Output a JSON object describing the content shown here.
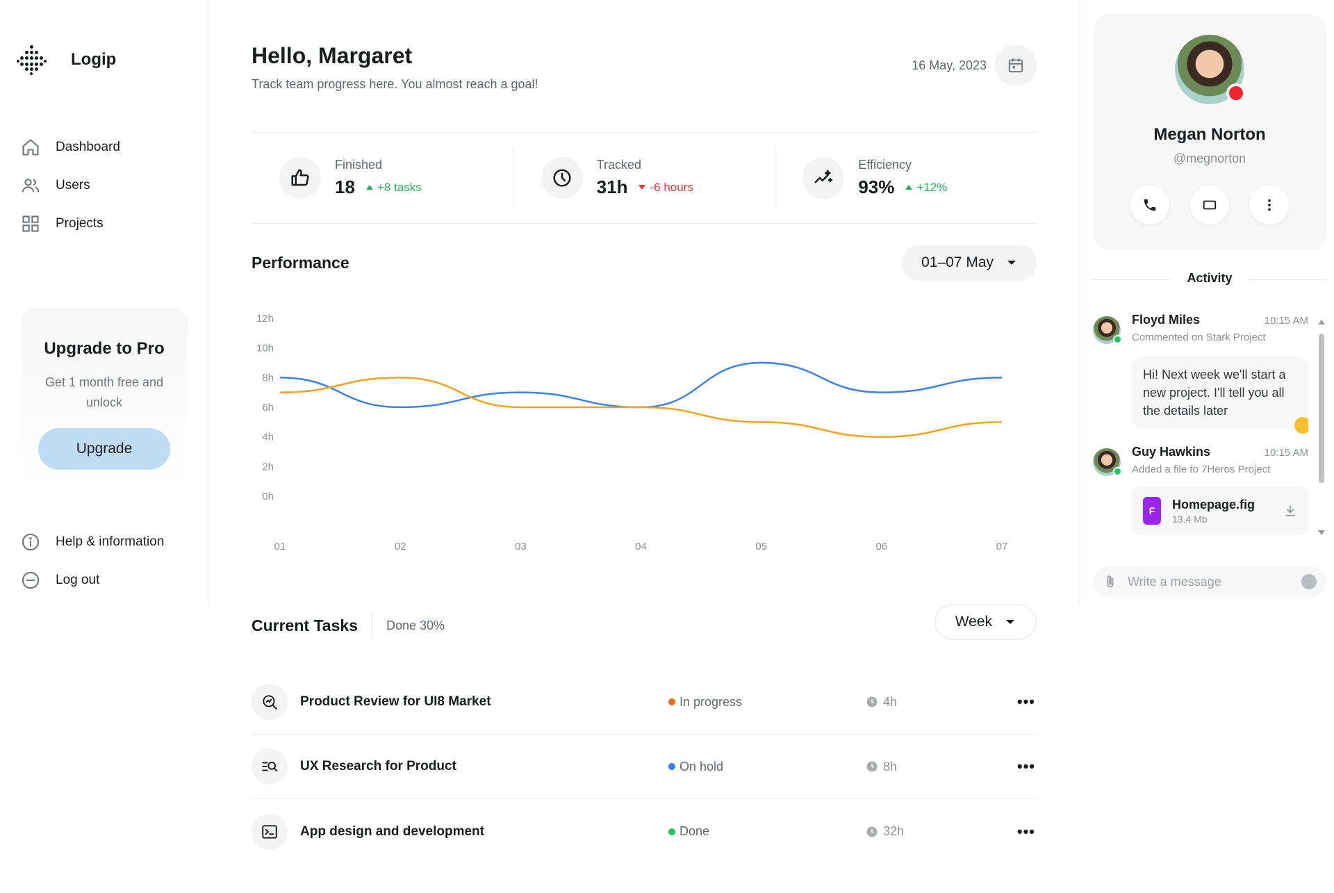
{
  "app": {
    "name": "Logip"
  },
  "sidebar": {
    "items": [
      {
        "label": "Dashboard",
        "icon": "home-icon"
      },
      {
        "label": "Users",
        "icon": "users-icon"
      },
      {
        "label": "Projects",
        "icon": "grid-icon"
      }
    ],
    "upgrade": {
      "title": "Upgrade to Pro",
      "text": "Get 1 month free and unlock",
      "button": "Upgrade"
    },
    "bottom_items": [
      {
        "label": "Help & information",
        "icon": "info-icon"
      },
      {
        "label": "Log out",
        "icon": "logout-icon"
      }
    ]
  },
  "header": {
    "greeting": "Hello, Margaret",
    "subtitle": "Track team progress here. You almost reach a goal!",
    "date": "16 May, 2023"
  },
  "stats": [
    {
      "label": "Finished",
      "value": "18",
      "delta": "+8 tasks",
      "trend": "up",
      "icon": "thumbs-up-icon"
    },
    {
      "label": "Tracked",
      "value": "31h",
      "delta": "-6 hours",
      "trend": "down",
      "icon": "clock-icon"
    },
    {
      "label": "Efficiency",
      "value": "93%",
      "delta": "+12%",
      "trend": "up",
      "icon": "sparkle-trend-icon"
    }
  ],
  "performance": {
    "title": "Performance",
    "range": "01–07 May"
  },
  "chart_data": {
    "type": "line",
    "x": [
      "01",
      "02",
      "03",
      "04",
      "05",
      "06",
      "07"
    ],
    "y_ticks": [
      "0h",
      "2h",
      "4h",
      "6h",
      "8h",
      "10h",
      "12h"
    ],
    "ylim": [
      0,
      12
    ],
    "series": [
      {
        "color": "#3b82e8",
        "values": [
          8,
          6,
          7,
          6,
          9,
          7,
          8
        ]
      },
      {
        "color": "#f4a11c",
        "values": [
          7,
          8,
          6,
          6,
          5,
          4,
          5
        ]
      }
    ],
    "grid": false
  },
  "tasks": {
    "title": "Current Tasks",
    "done": "Done 30%",
    "period": "Week",
    "items": [
      {
        "name": "Product Review for UI8 Market",
        "status": "In progress",
        "status_color": "#f26a1b",
        "time": "4h",
        "icon": "search-chart-icon"
      },
      {
        "name": "UX Research for Product",
        "status": "On hold",
        "status_color": "#2f7fef",
        "time": "8h",
        "icon": "list-search-icon"
      },
      {
        "name": "App design and development",
        "status": "Done",
        "status_color": "#1fc55e",
        "time": "32h",
        "icon": "terminal-icon"
      }
    ],
    "more": "•••"
  },
  "profile": {
    "name": "Megan Norton",
    "handle": "@megnorton"
  },
  "activity": {
    "title": "Activity",
    "items": [
      {
        "name": "Floyd Miles",
        "time": "10:15 AM",
        "sub": "Commented on Stark Project",
        "message": "Hi! Next week we'll start a new project. I'll tell you all the details later"
      },
      {
        "name": "Guy Hawkins",
        "time": "10:15 AM",
        "sub": "Added a file to 7Heros Project",
        "file": {
          "badge": "F",
          "name": "Homepage.fig",
          "size": "13.4 Mb"
        }
      }
    ],
    "message_placeholder": "Write a message"
  }
}
